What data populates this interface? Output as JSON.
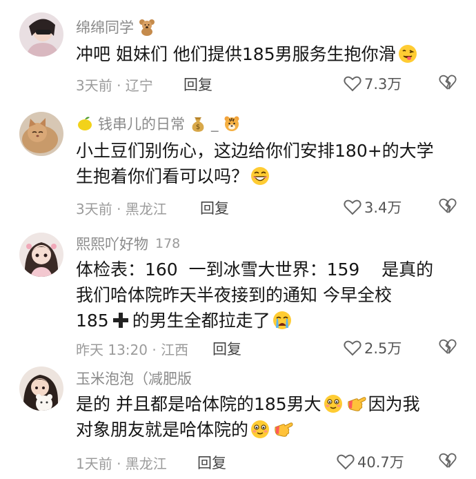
{
  "comments": [
    {
      "username": "绵绵同学",
      "username_badges": [
        "teddy-bear-icon"
      ],
      "extra": "",
      "text_parts": [
        "冲吧 姐妹们 他们提供185男服务生抱你滑"
      ],
      "text_emojis": [
        "winking-tongue-emoji"
      ],
      "meta": "3天前 · 辽宁",
      "reply_label": "回复",
      "likes": "7.3万"
    },
    {
      "username": "钱串儿的日常",
      "username_prefix_badge": "lemon-icon",
      "username_badges": [
        "money-bag-icon",
        "tiger-icon"
      ],
      "username_sep": "_",
      "extra": "",
      "text_line1": "小土豆们别伤心，这边给你们安排180+的大学",
      "text_line2": "生抱着你们看可以吗？",
      "text_emojis": [
        "grinning-emoji"
      ],
      "meta": "3天前 · 黑龙江",
      "reply_label": "回复",
      "likes": "3.4万"
    },
    {
      "username": "熙熙吖好物",
      "extra": "178",
      "text_line1": "体检表：160  一到冰雪大世界：159    是真的",
      "text_line2": "我们哈体院昨天半夜接到的通知 今早全校",
      "text_line3_a": "185",
      "text_line3_b": "的男生全都拉走了",
      "text_emojis": [
        "plus-emoji",
        "crying-emoji"
      ],
      "meta": "昨天 13:20 · 江西",
      "reply_label": "回复",
      "likes": "2.5万"
    },
    {
      "username": "玉米泡泡（减肥版",
      "extra": "",
      "text_line1_a": "是的 并且都是哈体院的185男大",
      "text_line1_b": "因为我",
      "text_line2": "对象朋友就是哈体院的",
      "text_emojis": [
        "shy-emoji",
        "pointing-hand-emoji"
      ],
      "meta": "1天前 · 黑龙江",
      "reply_label": "回复",
      "likes": "40.7万"
    }
  ],
  "icons": {
    "like": "heart-outline-icon",
    "dislike": "broken-heart-outline-icon"
  },
  "colors": {
    "username": "#8a8a8a",
    "body": "#161616",
    "meta": "#9b9b9b",
    "reply": "#444444"
  }
}
